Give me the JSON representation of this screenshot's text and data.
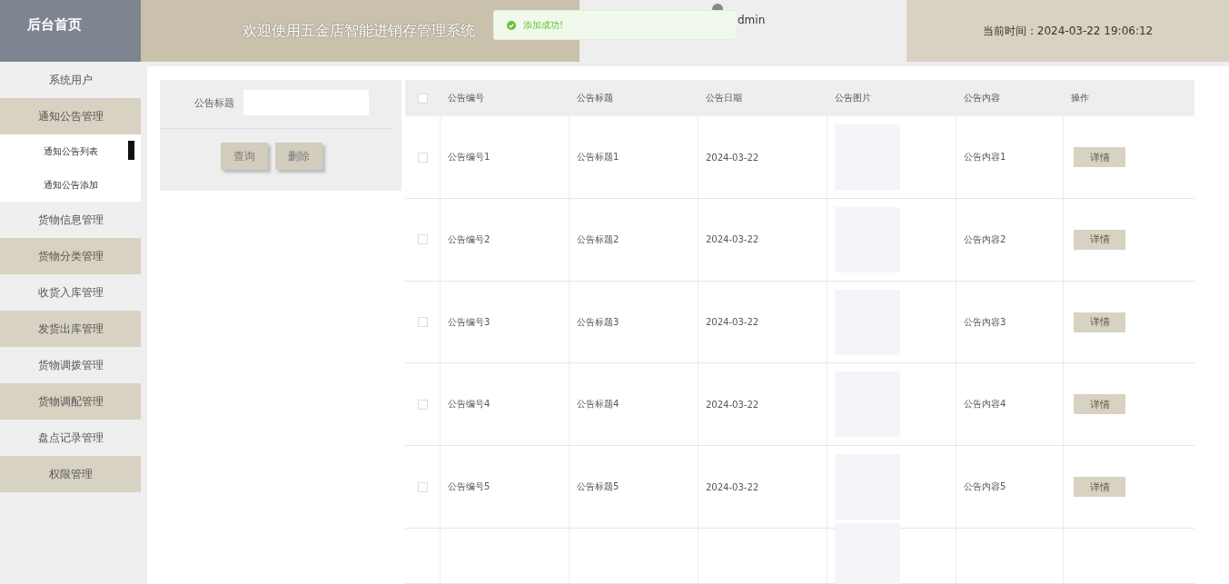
{
  "header": {
    "logo": "后台首页",
    "title": "欢迎使用五金店智能进销存管理系统",
    "user": "dmin",
    "time": "当前时间：2024-03-22 19:06:12"
  },
  "toast": {
    "message": "添加成功!"
  },
  "sidebar": {
    "items": [
      {
        "label": "系统用户"
      },
      {
        "label": "通知公告管理",
        "children": [
          {
            "label": "通知公告列表",
            "selected": true
          },
          {
            "label": "通知公告添加",
            "selected": false
          }
        ]
      },
      {
        "label": "货物信息管理"
      },
      {
        "label": "货物分类管理"
      },
      {
        "label": "收货入库管理"
      },
      {
        "label": "发货出库管理"
      },
      {
        "label": "货物调拨管理"
      },
      {
        "label": "货物调配管理"
      },
      {
        "label": "盘点记录管理"
      },
      {
        "label": "权限管理"
      }
    ]
  },
  "search": {
    "label": "公告标题",
    "buttons": [
      "查询",
      "删除"
    ]
  },
  "table": {
    "all_checked": false,
    "columns": [
      "公告编号",
      "公告标题",
      "公告日期",
      "公告图片",
      "公告内容",
      "操作"
    ],
    "rows": [
      {
        "checked": false,
        "cells": [
          "公告编号1",
          "公告标题1",
          "2024-03-22",
          "公告内容1"
        ],
        "action": "详情"
      },
      {
        "checked": false,
        "cells": [
          "公告编号2",
          "公告标题2",
          "2024-03-22",
          "公告内容2"
        ],
        "action": "详情"
      },
      {
        "checked": false,
        "cells": [
          "公告编号3",
          "公告标题3",
          "2024-03-22",
          "公告内容3"
        ],
        "action": "详情"
      },
      {
        "checked": false,
        "cells": [
          "公告编号4",
          "公告标题4",
          "2024-03-22",
          "公告内容4"
        ],
        "action": "详情"
      },
      {
        "checked": false,
        "cells": [
          "公告编号5",
          "公告标题5",
          "2024-03-22",
          "公告内容5"
        ],
        "action": "详情"
      }
    ]
  }
}
